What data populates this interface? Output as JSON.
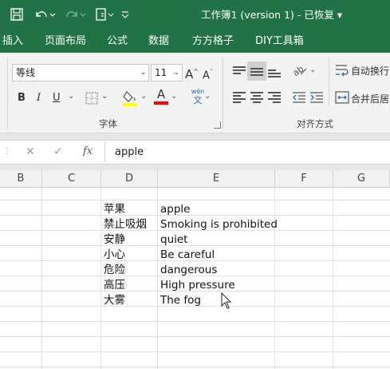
{
  "titlebar": {
    "title": "工作簿1 (version 1)  -  已恢复 ▾",
    "save_icon": "save-icon",
    "undo_icon": "undo-icon",
    "redo_icon": "redo-icon",
    "customize_icon": "customize-quick-access-icon",
    "accent_color": "#217346"
  },
  "tabs": [
    "插入",
    "页面布局",
    "公式",
    "数据",
    "方方格子",
    "DIY工具箱"
  ],
  "ribbon": {
    "font_name": "等线",
    "font_size": "11",
    "bold": "B",
    "italic": "I",
    "underline": "U",
    "grow_font": "A",
    "shrink_font": "A",
    "font_color_label": "A",
    "phonetic_top": "wén",
    "phonetic_bottom": "文",
    "font_group_label": "字体",
    "wrap_text": "自动换行",
    "merge_center": "合并后居中",
    "align_group_label": "对齐方式",
    "fill_color": "#ffff00",
    "font_color": "#ff0000"
  },
  "formula_bar": {
    "cancel": "✕",
    "enter": "✓",
    "fx": "fx",
    "value": "apple"
  },
  "columns": [
    "B",
    "C",
    "D",
    "E",
    "F",
    "G"
  ],
  "rows": [
    {
      "d": "苹果",
      "e": "apple"
    },
    {
      "d": "禁止吸烟",
      "e": "Smoking is prohibited"
    },
    {
      "d": "安静",
      "e": "quiet"
    },
    {
      "d": "小心",
      "e": "Be careful"
    },
    {
      "d": "危险",
      "e": "dangerous"
    },
    {
      "d": "高压",
      "e": "High pressure"
    },
    {
      "d": "大雾",
      "e": "The fog"
    }
  ]
}
